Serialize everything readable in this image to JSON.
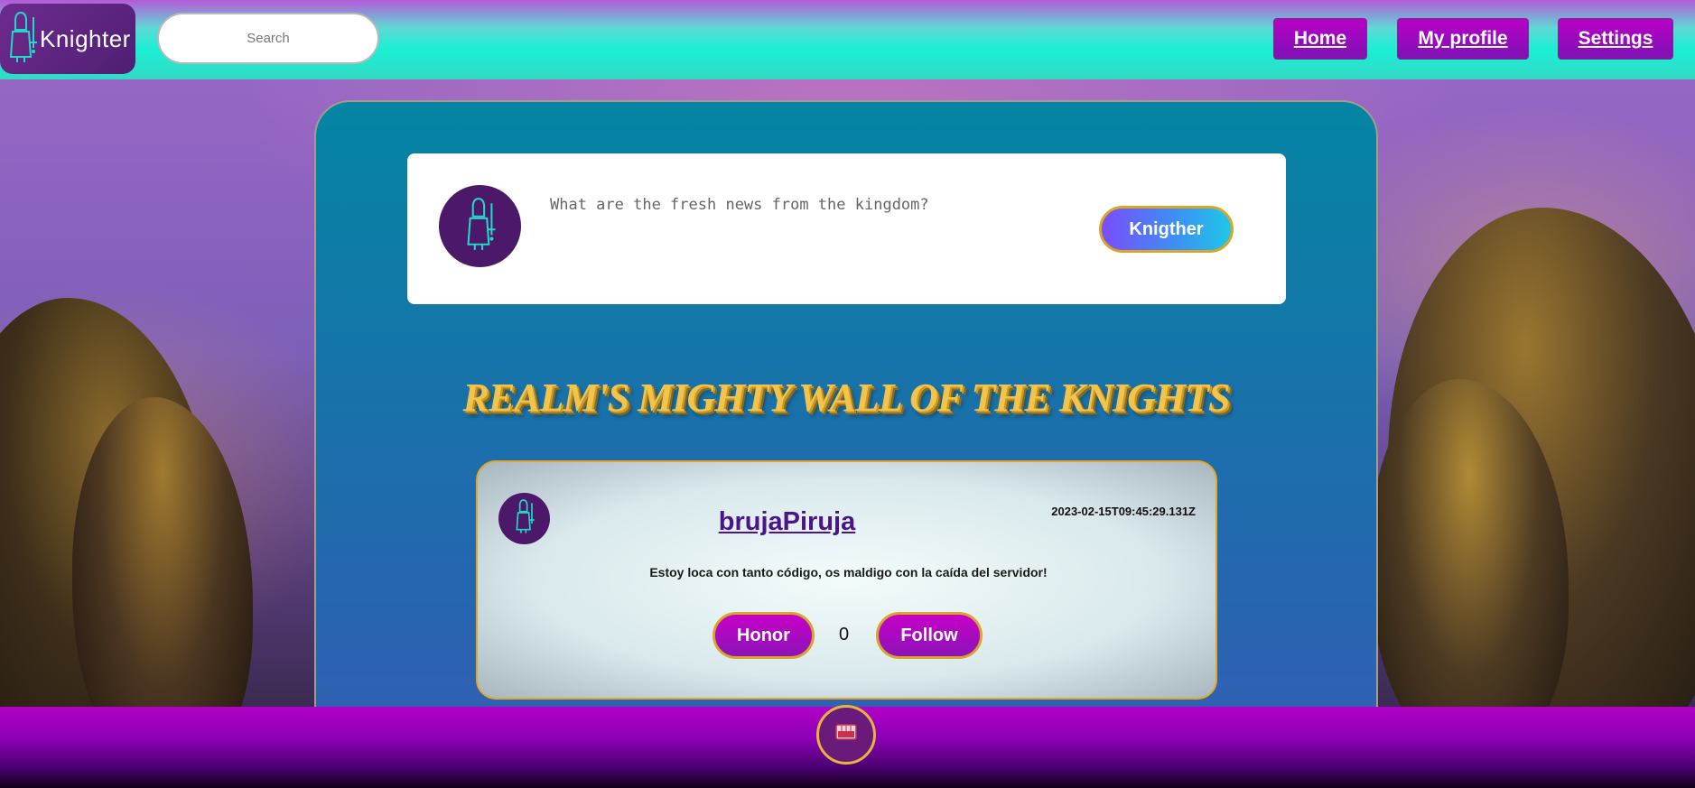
{
  "header": {
    "logo_text": "Knighter",
    "search_placeholder": "Search",
    "nav": {
      "home": "Home",
      "profile": "My profile",
      "settings": "Settings"
    }
  },
  "compose": {
    "placeholder": "What are the fresh news from the kingdom?",
    "submit_label": "Knigther",
    "avatar_icon": "knight-icon"
  },
  "wall": {
    "title": "REALM'S MIGHTY WALL OF THE KNIGHTS"
  },
  "posts": [
    {
      "username": "brujaPiruja",
      "timestamp": "2023-02-15T09:45:29.131Z",
      "text": "Estoy loca con tanto código, os maldigo con la caída del servidor!",
      "honor_label": "Honor",
      "honor_count": "0",
      "follow_label": "Follow",
      "avatar_icon": "knight-icon"
    }
  ],
  "footer": {
    "badge_icon": "crest-icon"
  },
  "colors": {
    "header_accent": "#19f0d5",
    "button_purple": "#b800c6",
    "panel_blue": "#0485a3",
    "title_gold": "#f3c44c",
    "border_gold": "#d9a62a"
  }
}
